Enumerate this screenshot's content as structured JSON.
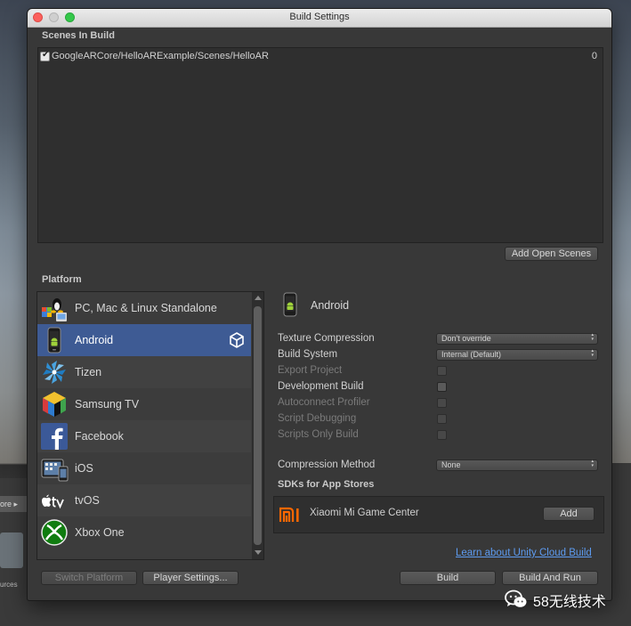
{
  "background": {
    "left_tab_label": "ore ▸",
    "left_text": "urces"
  },
  "window": {
    "title": "Build Settings"
  },
  "scenes": {
    "header": "Scenes In Build",
    "items": [
      {
        "path": "GoogleARCore/HelloARExample/Scenes/HelloAR",
        "index": "0",
        "checked": true
      }
    ],
    "add_open_scenes_label": "Add Open Scenes"
  },
  "platform": {
    "header": "Platform",
    "items": [
      {
        "label": "PC, Mac & Linux Standalone",
        "icon": "pc-mac-linux-icon"
      },
      {
        "label": "Android",
        "icon": "android-phone-icon",
        "selected": true
      },
      {
        "label": "Tizen",
        "icon": "tizen-icon"
      },
      {
        "label": "Samsung TV",
        "icon": "samsung-tv-icon"
      },
      {
        "label": "Facebook",
        "icon": "facebook-icon"
      },
      {
        "label": "iOS",
        "icon": "ios-device-icon"
      },
      {
        "label": "tvOS",
        "icon": "apple-tv-icon"
      },
      {
        "label": "Xbox One",
        "icon": "xbox-icon"
      }
    ]
  },
  "settings": {
    "platform_title": "Android",
    "texture_compression": {
      "label": "Texture Compression",
      "value": "Don't override"
    },
    "build_system": {
      "label": "Build System",
      "value": "Internal (Default)"
    },
    "export_project": {
      "label": "Export Project"
    },
    "development_build": {
      "label": "Development Build"
    },
    "autoconnect_profiler": {
      "label": "Autoconnect Profiler"
    },
    "script_debugging": {
      "label": "Script Debugging"
    },
    "scripts_only_build": {
      "label": "Scripts Only Build"
    },
    "compression_method": {
      "label": "Compression Method",
      "value": "None"
    },
    "sdks_header": "SDKs for App Stores",
    "sdk_item": {
      "label": "Xiaomi Mi Game Center",
      "add_label": "Add"
    },
    "cloud_build_link": "Learn about Unity Cloud Build"
  },
  "footer": {
    "switch_platform_label": "Switch Platform",
    "player_settings_label": "Player Settings...",
    "build_label": "Build",
    "build_and_run_label": "Build And Run"
  },
  "watermark": {
    "text": "58无线技术",
    "icon": "wechat-icon"
  },
  "colors": {
    "selected_row": "#3e5b94",
    "link": "#5d9bf0",
    "xiaomi_orange": "#ff6700",
    "xbox_green": "#107c10",
    "facebook_blue": "#3b5998"
  }
}
